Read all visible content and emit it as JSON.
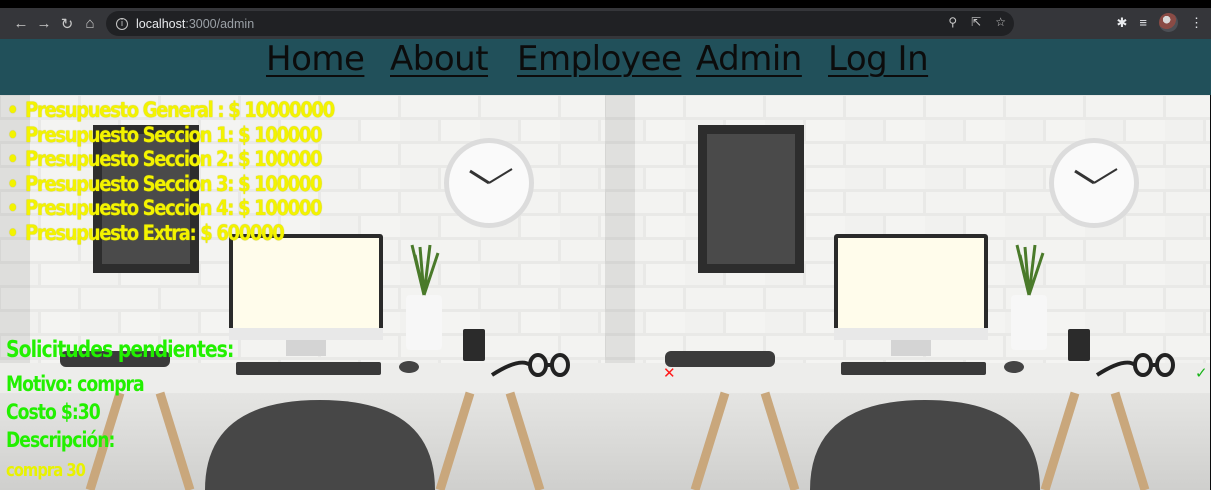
{
  "browser": {
    "url_host": "localhost",
    "url_path": ":3000/admin",
    "icons": [
      "back-arrow-icon",
      "forward-arrow-icon",
      "reload-icon",
      "home-icon",
      "info-icon",
      "zoom-icon",
      "share-icon",
      "star-icon",
      "extensions-icon",
      "reading-list-icon",
      "profile-avatar",
      "menu-dots-icon"
    ]
  },
  "nav": {
    "home": "Home",
    "about": "About",
    "employee": "Employee",
    "admin": "Admin",
    "login": "Log In"
  },
  "budget": {
    "items": [
      "Presupuesto General : $ 10000000",
      "Presupuesto Seccion 1: $ 100000",
      "Presupuesto Seccion 2: $ 100000",
      "Presupuesto Seccion 3: $ 100000",
      "Presupuesto Seccion 4: $ 100000",
      "Presupuesto Extra: $ 600000"
    ]
  },
  "requests": {
    "title": "Solicitudes pendientes:",
    "motivo": "Motivo: compra",
    "costo": "Costo $:30",
    "descripcion_label": "Descripción:",
    "descripcion_value": "compra 30",
    "reject_symbol": "✕",
    "approve_symbol": "✓"
  },
  "colors": {
    "nav_bg": "#21505a",
    "budget_text": "#f3f300",
    "request_text": "#22f000",
    "reject": "#ff1a1a",
    "approve": "#18b418"
  }
}
